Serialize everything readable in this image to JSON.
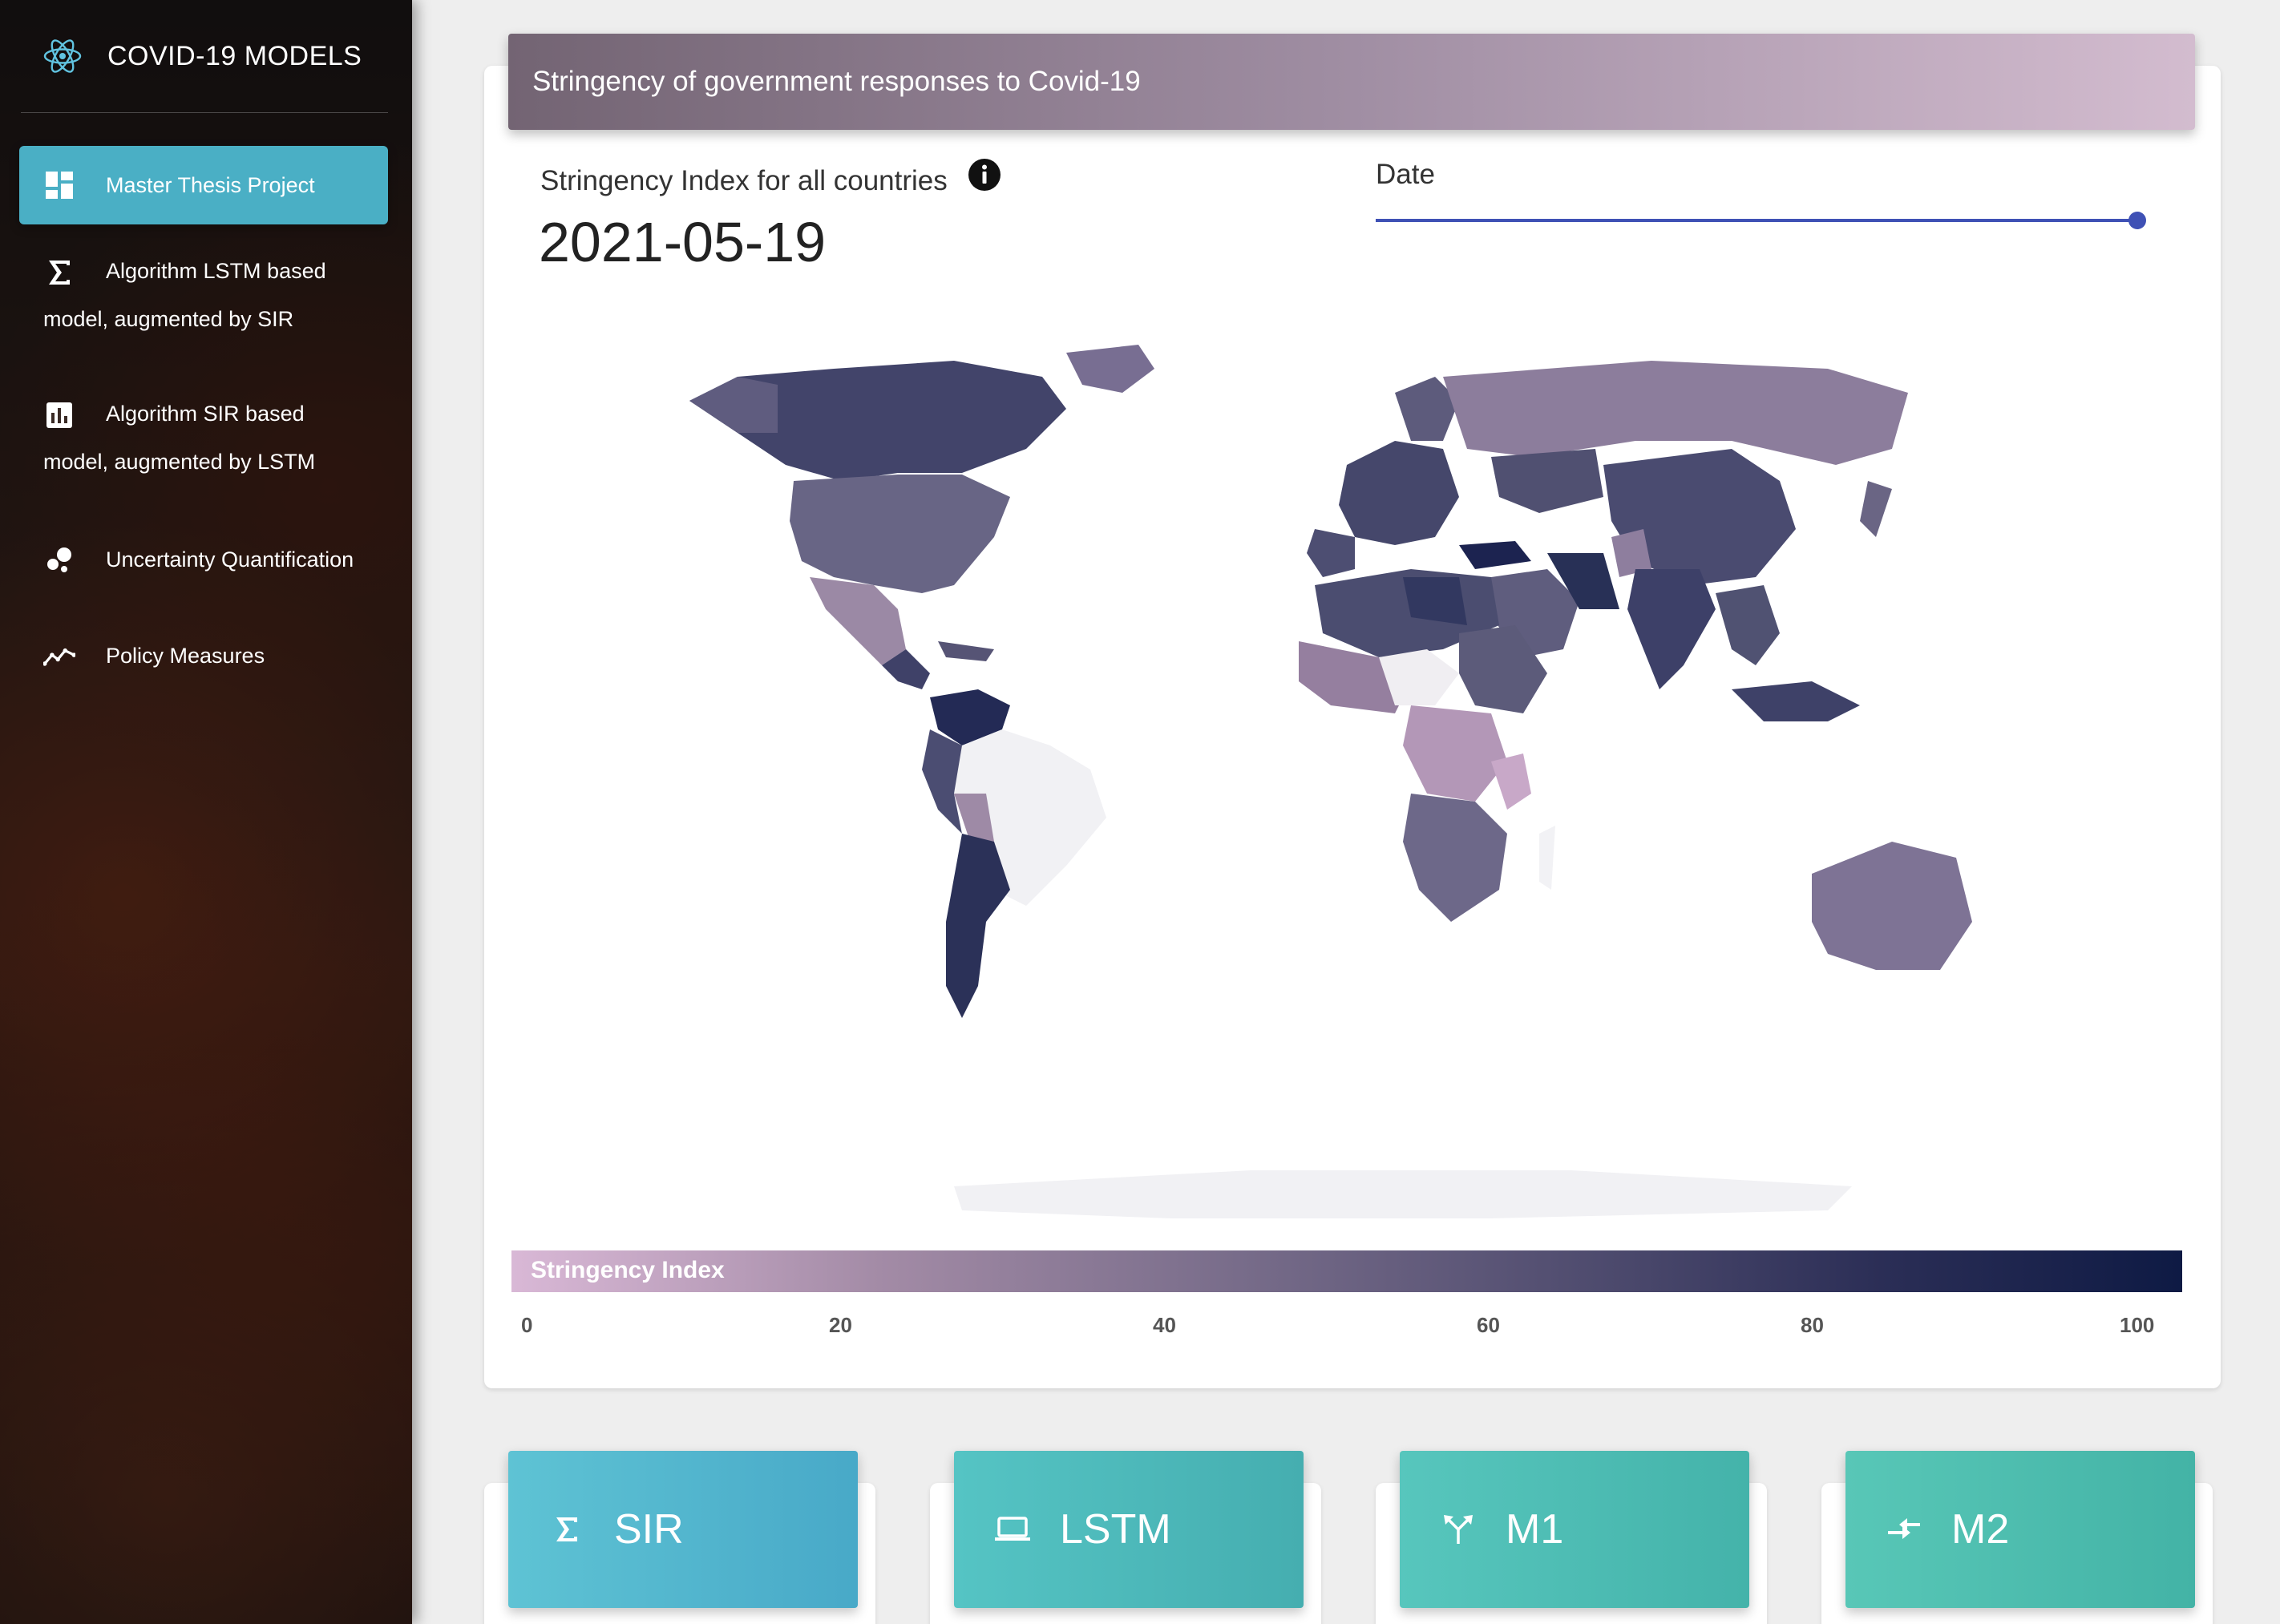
{
  "sidebar": {
    "brand": "COVID-19 MODELS",
    "items": [
      {
        "label": "Master Thesis Project",
        "icon": "dashboard-icon"
      },
      {
        "label_line1": "Algorithm LSTM based",
        "label_line2": "model, augmented by SIR",
        "icon": "sigma-icon"
      },
      {
        "label_line1": "Algorithm SIR based",
        "label_line2": "model, augmented by LSTM",
        "icon": "bar-chart-icon"
      },
      {
        "label": "Uncertainty Quantification",
        "icon": "bubble-icon"
      },
      {
        "label": "Policy Measures",
        "icon": "trend-line-icon"
      }
    ]
  },
  "main": {
    "header": "Stringency of government responses to Covid-19",
    "index_label": "Stringency Index for all countries",
    "date_value": "2021-05-19",
    "date_label": "Date",
    "slider_position": 0.99,
    "colorbar": {
      "title": "Stringency Index",
      "ticks": [
        "0",
        "20",
        "40",
        "60",
        "80",
        "100"
      ],
      "min_color": "#d9b8d6",
      "max_color": "#0e1a44"
    }
  },
  "models": [
    {
      "label": "SIR",
      "icon": "sigma-icon"
    },
    {
      "label": "LSTM",
      "icon": "laptop-icon"
    },
    {
      "label": "M1",
      "icon": "merge-icon"
    },
    {
      "label": "M2",
      "icon": "compare-arrows-icon"
    }
  ],
  "colors": {
    "accent": "#4aafc5",
    "slider": "#3f51b5"
  }
}
